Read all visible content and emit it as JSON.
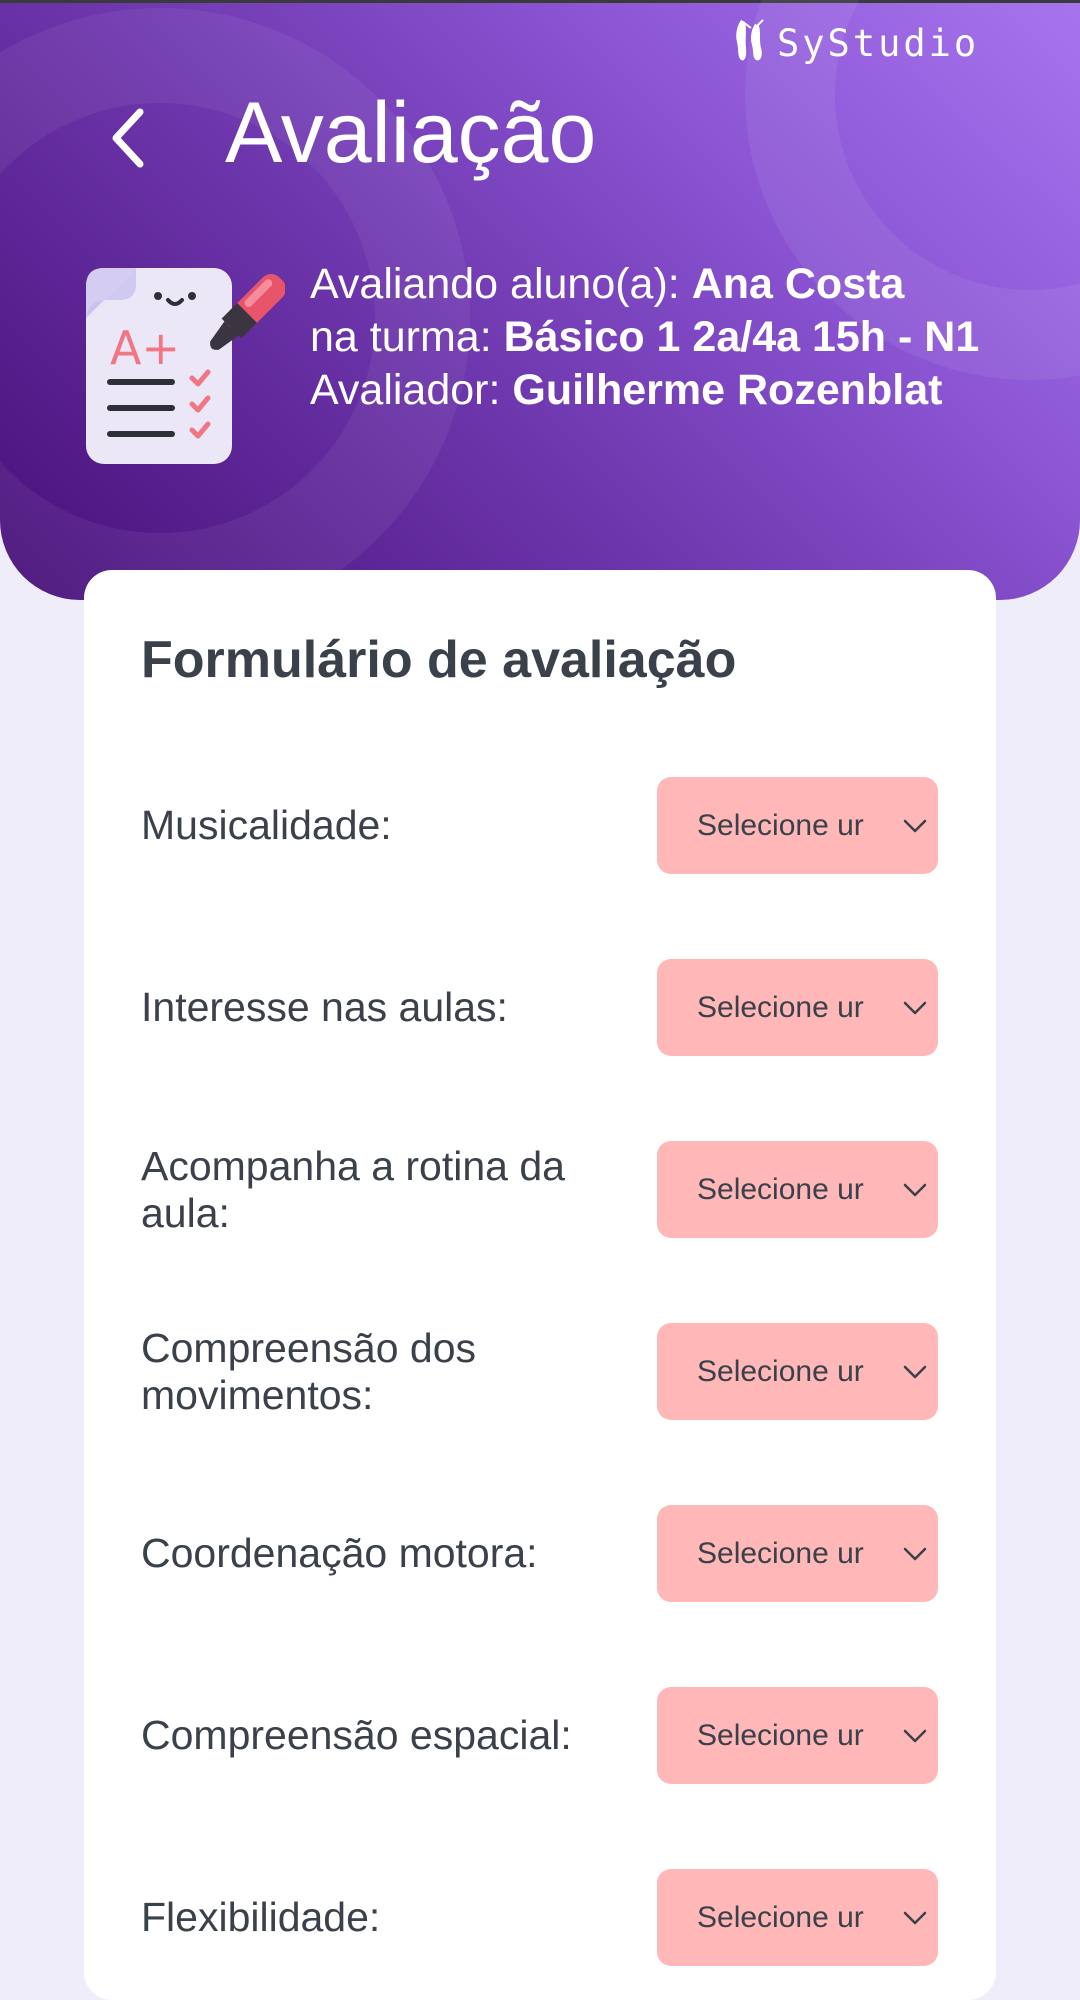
{
  "brand": {
    "name": "SyStudio",
    "icon": "ballet-shoes-icon"
  },
  "header": {
    "title": "Avaliação",
    "back_icon": "chevron-left-icon",
    "illustration": "evaluation-sheet-icon",
    "illustration_text": "A+",
    "student_label": "Avaliando aluno(a): ",
    "student_name": "Ana Costa",
    "class_label": "na turma: ",
    "class_name": "Básico 1 2a/4a 15h - N1",
    "evaluator_label": "Avaliador: ",
    "evaluator_name": "Guilherme Rozenblat"
  },
  "form": {
    "title": "Formulário de avaliação",
    "fields": [
      {
        "label": "Musicalidade:",
        "value": "Selecione ur"
      },
      {
        "label": "Interesse nas aulas:",
        "value": "Selecione ur"
      },
      {
        "label": "Acompanha a rotina da aula:",
        "value": "Selecione ur"
      },
      {
        "label": "Compreensão dos movimentos:",
        "value": "Selecione ur"
      },
      {
        "label": "Coordenação motora:",
        "value": "Selecione ur"
      },
      {
        "label": "Compreensão espacial:",
        "value": "Selecione ur"
      },
      {
        "label": "Flexibilidade:",
        "value": "Selecione ur"
      }
    ]
  },
  "colors": {
    "header_gradient": [
      "#a874ee",
      "#470f78"
    ],
    "select_bg": "#ffb7b8",
    "page_bg": "#efedf9",
    "text_dark": "#3a414a"
  }
}
